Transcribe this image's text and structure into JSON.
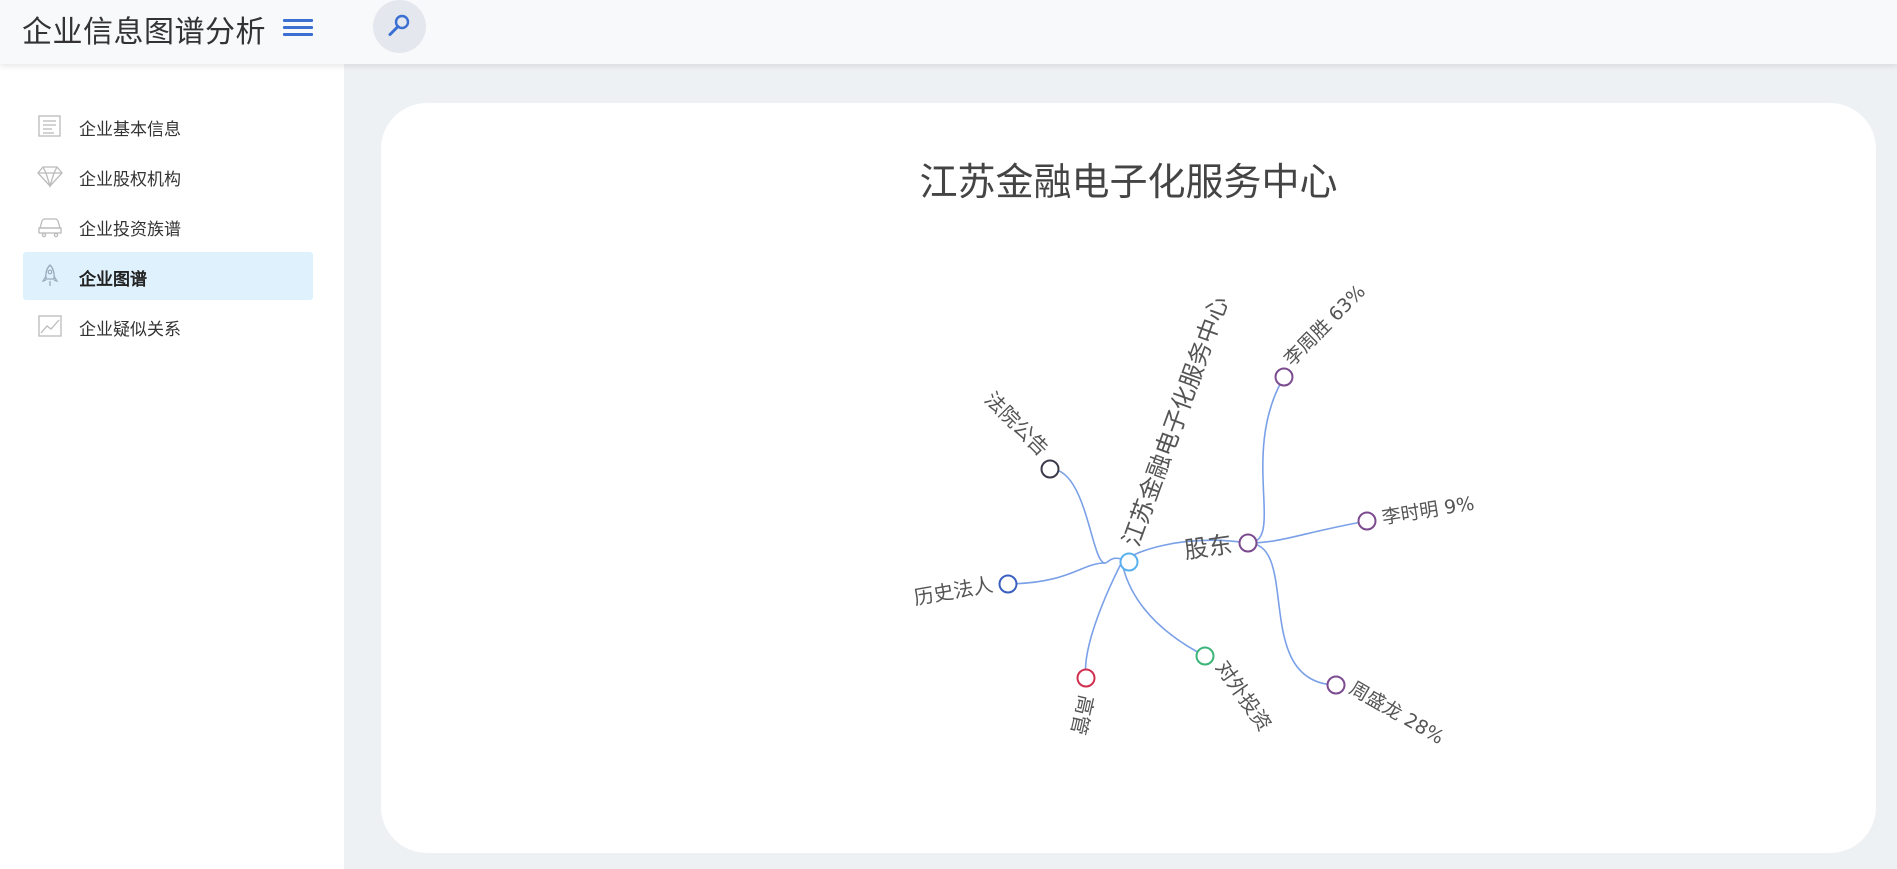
{
  "header": {
    "app_title": "企业信息图谱分析",
    "menu_icon": "hamburger-menu-icon",
    "search_icon": "search-icon"
  },
  "sidebar": {
    "items": [
      {
        "label": "企业基本信息",
        "icon": "document-icon",
        "active": false
      },
      {
        "label": "企业股权机构",
        "icon": "diamond-icon",
        "active": false
      },
      {
        "label": "企业投资族谱",
        "icon": "car-icon",
        "active": false
      },
      {
        "label": "企业图谱",
        "icon": "rocket-icon",
        "active": true
      },
      {
        "label": "企业疑似关系",
        "icon": "line-chart-icon",
        "active": false
      }
    ]
  },
  "graph": {
    "title": "江苏金融电子化服务中心",
    "center_label": "江苏金融电子化服务中心",
    "branches": {
      "court": "法院公告",
      "legal_rep": "历史法人",
      "executives": "高管",
      "investment": "对外投资",
      "shareholders": "股东"
    },
    "shareholders": [
      {
        "label": "李周胜 63%"
      },
      {
        "label": "李时明 9%"
      },
      {
        "label": "周盛龙 28%"
      }
    ],
    "colors": {
      "link": "#7aa0e8",
      "center": "#5ab0ee",
      "court": "#3a3a4a",
      "legal_rep": "#3b5fc0",
      "executives": "#d0304f",
      "investment": "#3bb57a",
      "shareholders": "#7b4a8f"
    }
  }
}
